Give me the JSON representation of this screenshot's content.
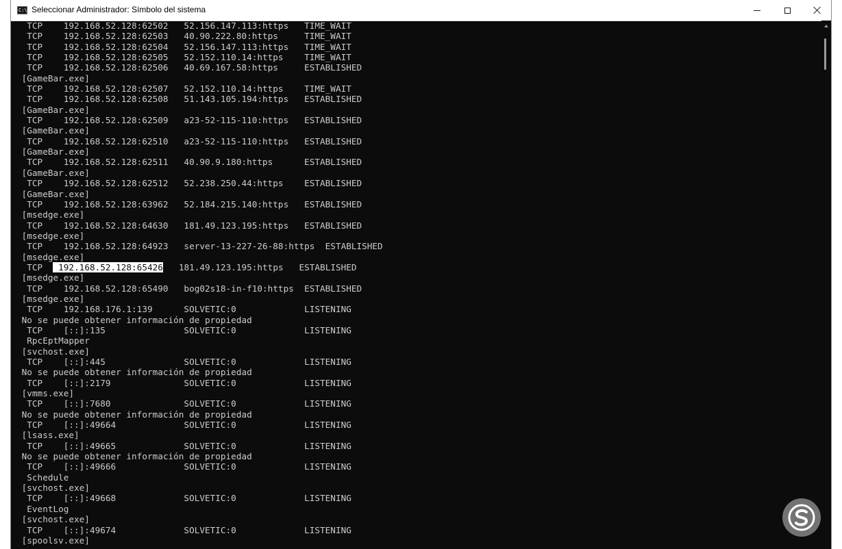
{
  "window": {
    "title": "Seleccionar Administrador: Símbolo del sistema",
    "icon": "cmd-icon",
    "icon_text": "C:\\"
  },
  "controls": {
    "minimize": "minimize-icon",
    "maximize": "maximize-icon",
    "close": "close-icon"
  },
  "console": {
    "lines": [
      "  TCP    192.168.52.128:62502   52.156.147.113:https   TIME_WAIT",
      "  TCP    192.168.52.128:62503   40.90.222.80:https     TIME_WAIT",
      "  TCP    192.168.52.128:62504   52.156.147.113:https   TIME_WAIT",
      "  TCP    192.168.52.128:62505   52.152.110.14:https    TIME_WAIT",
      "  TCP    192.168.52.128:62506   40.69.167.58:https     ESTABLISHED",
      " [GameBar.exe]",
      "  TCP    192.168.52.128:62507   52.152.110.14:https    TIME_WAIT",
      "  TCP    192.168.52.128:62508   51.143.105.194:https   ESTABLISHED",
      " [GameBar.exe]",
      "  TCP    192.168.52.128:62509   a23-52-115-110:https   ESTABLISHED",
      " [GameBar.exe]",
      "  TCP    192.168.52.128:62510   a23-52-115-110:https   ESTABLISHED",
      " [GameBar.exe]",
      "  TCP    192.168.52.128:62511   40.90.9.180:https      ESTABLISHED",
      " [GameBar.exe]",
      "  TCP    192.168.52.128:62512   52.238.250.44:https    ESTABLISHED",
      " [GameBar.exe]",
      "  TCP    192.168.52.128:63962   52.184.215.140:https   ESTABLISHED",
      " [msedge.exe]",
      "  TCP    192.168.52.128:64630   181.49.123.195:https   ESTABLISHED",
      " [msedge.exe]",
      "  TCP    192.168.52.128:64923   server-13-227-26-88:https  ESTABLISHED",
      " [msedge.exe]",
      "  TCP    192.168.52.128:65426   181.49.123.195:https   ESTABLISHED",
      " [msedge.exe]",
      "  TCP    192.168.52.128:65490   bog02s18-in-f10:https  ESTABLISHED",
      " [msedge.exe]",
      "  TCP    192.168.176.1:139      SOLVETIC:0             LISTENING",
      " No se puede obtener información de propiedad",
      "  TCP    [::]:135               SOLVETIC:0             LISTENING",
      "  RpcEptMapper",
      " [svchost.exe]",
      "  TCP    [::]:445               SOLVETIC:0             LISTENING",
      " No se puede obtener información de propiedad",
      "  TCP    [::]:2179              SOLVETIC:0             LISTENING",
      " [vmms.exe]",
      "  TCP    [::]:7680              SOLVETIC:0             LISTENING",
      " No se puede obtener información de propiedad",
      "  TCP    [::]:49664             SOLVETIC:0             LISTENING",
      " [lsass.exe]",
      "  TCP    [::]:49665             SOLVETIC:0             LISTENING",
      " No se puede obtener información de propiedad",
      "  TCP    [::]:49666             SOLVETIC:0             LISTENING",
      "  Schedule",
      " [svchost.exe]",
      "  TCP    [::]:49668             SOLVETIC:0             LISTENING",
      "  EventLog",
      " [svchost.exe]",
      "  TCP    [::]:49674             SOLVETIC:0             LISTENING",
      " [spoolsv.exe]"
    ],
    "selection": {
      "line_index": 23,
      "prefix": "  TCP  ",
      "selected_text": " 192.168.52.128:65426",
      "suffix": "   181.49.123.195:https   ESTABLISHED"
    }
  },
  "watermark": {
    "icon": "solvetic-logo-icon"
  }
}
